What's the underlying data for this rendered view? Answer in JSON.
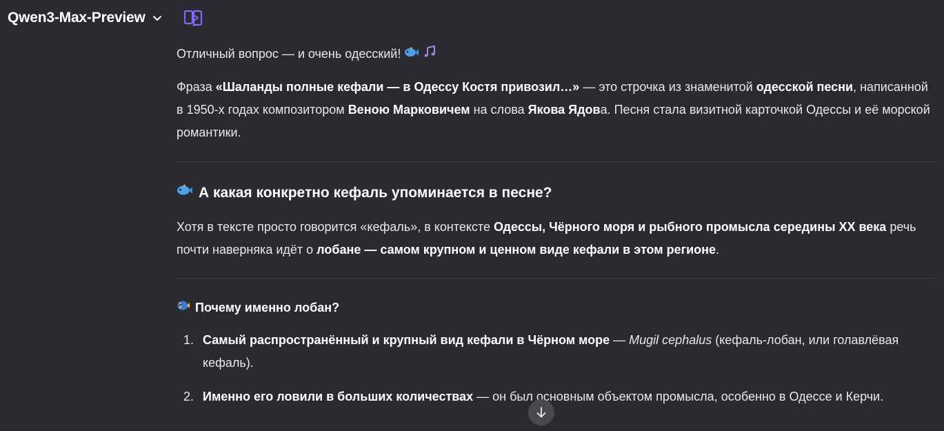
{
  "header": {
    "model_name": "Qwen3-Max-Preview",
    "icons": {
      "chevron": "chevron-down-icon",
      "compare": "split-compare-icon"
    }
  },
  "message": {
    "intro": "Отличный вопрос — и очень одесский!",
    "intro_emojis": [
      "fish-emoji",
      "musical-notes-emoji"
    ],
    "phrase": {
      "t1": "Фраза ",
      "b1": "«Шаланды полные кефали — в Одессу Костя привозил…»",
      "t2": " — это строчка из знаменитой ",
      "b2": "одесской песни",
      "t3": ", написанной в 1950-х годах композитором ",
      "b3": "Веною Марковичем",
      "t4": " на слова ",
      "b4": "Якова Ядов",
      "t5": "а. Песня стала визитной карточкой Одессы и её морской романтики."
    },
    "section_heading": "А какая конкретно кефаль упоминается в песне?",
    "context": {
      "t1": "Хотя в тексте просто говорится «кефаль», в контексте ",
      "b1": "Одессы, Чёрного моря и рыбного промысла середины XX века",
      "t2": " речь почти наверняка идёт о ",
      "b2": "лобане — самом крупном и ценном виде кефали в этом регионе",
      "t3": "."
    },
    "subheading": "Почему именно лобан?",
    "list": [
      {
        "num": "1.",
        "bold": "Самый распространённый и крупный вид кефали в Чёрном море",
        "t1": " — ",
        "italic": "Mugil cephalus",
        "t2": " (кефаль-лобан, или голавлёвая кефаль)."
      },
      {
        "num": "2.",
        "bold": "Именно его ловили в больших количествах",
        "t1": " — он был основным объектом промысла, особенно в Одессе и Керчи."
      }
    ]
  },
  "colors": {
    "background": "#2b2a31",
    "text": "#e9e8ee",
    "accent": "#7b6cf6",
    "divider": "#3f3e46",
    "scroll_button": "#4a4950"
  }
}
